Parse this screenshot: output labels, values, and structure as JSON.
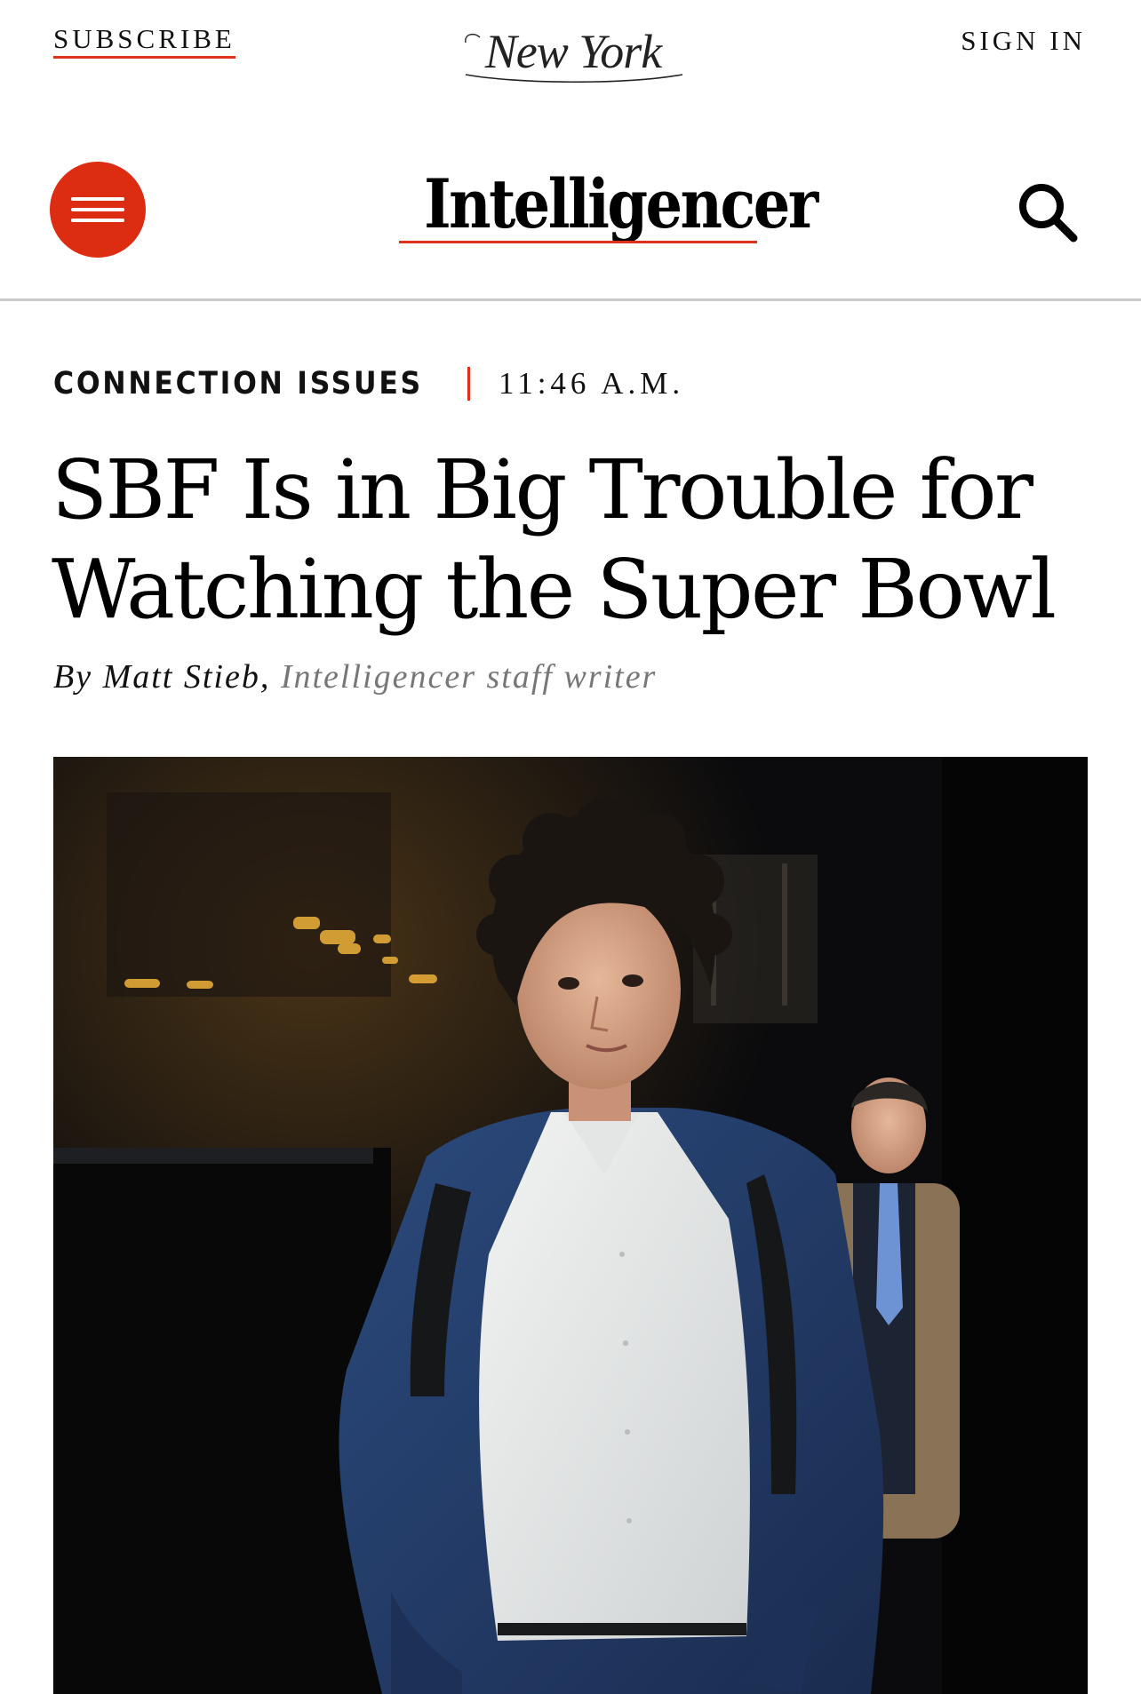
{
  "header": {
    "subscribe_label": "SUBSCRIBE",
    "brand_logo_text": "New York",
    "signin_label": "SIGN IN"
  },
  "nav": {
    "menu_icon": "hamburger-menu-icon",
    "section_title": "Intelligencer",
    "search_icon": "search-icon"
  },
  "article": {
    "rubric": "CONNECTION ISSUES",
    "timestamp": "11:46 A.M.",
    "headline": "SBF Is in Big Trouble for Watching the Super Bowl",
    "byline_prefix": "By Matt Stieb,",
    "byline_role": "Intelligencer staff writer"
  },
  "colors": {
    "accent_red": "#dc2d12",
    "text": "#111111",
    "muted": "#777777",
    "divider": "#c9c9c9"
  }
}
